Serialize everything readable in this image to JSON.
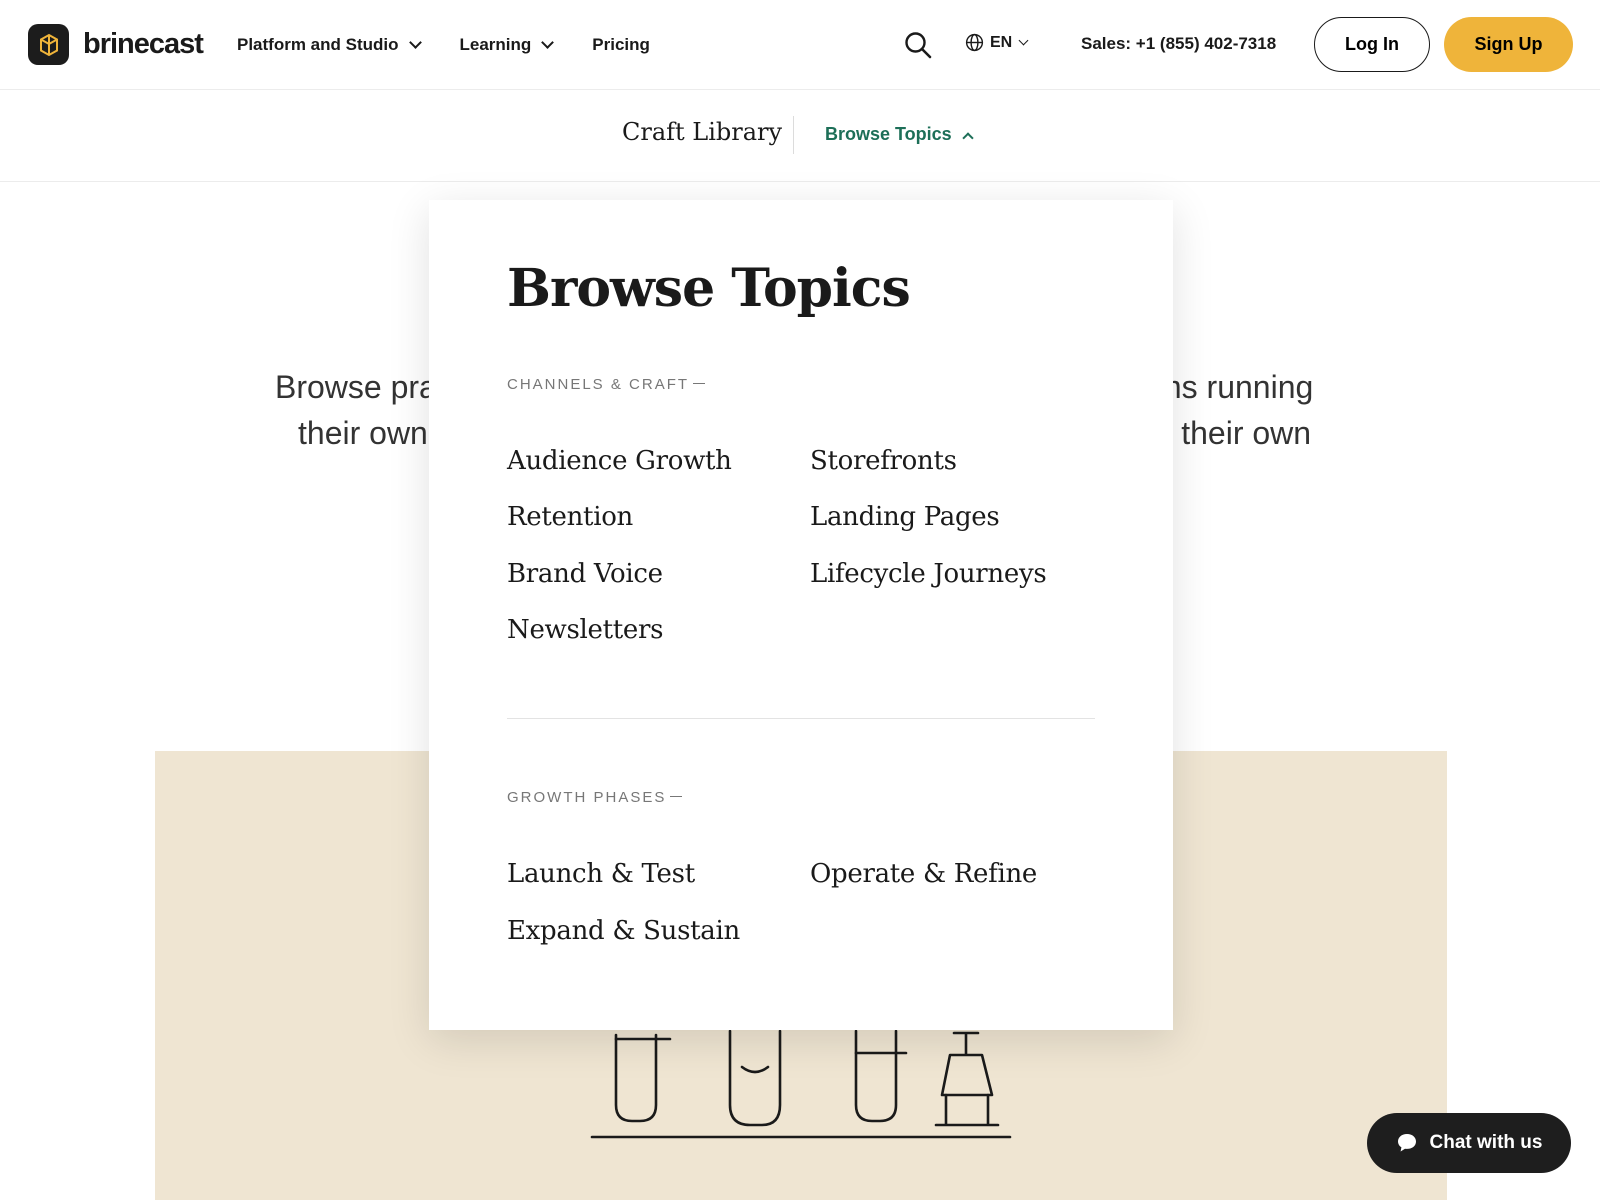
{
  "brand": {
    "name": "brinecast",
    "accent_color": "#efb43a",
    "link_color": "#1d6f58"
  },
  "topnav": {
    "links": [
      {
        "label": "Platform and Studio",
        "has_dropdown": true
      },
      {
        "label": "Learning",
        "has_dropdown": true
      },
      {
        "label": "Pricing",
        "has_dropdown": false
      }
    ],
    "search_icon": "search-icon",
    "language": "EN",
    "sales": "Sales: +1 (855) 402-7318",
    "login_label": "Log In",
    "signup_label": "Sign Up"
  },
  "subnav": {
    "library_label": "Craft Library",
    "browse_label": "Browse Topics"
  },
  "hero": {
    "left_line1": "Browse pra",
    "left_line2": "their own",
    "right_line1": "ms running",
    "right_line2": "their own"
  },
  "topics_panel": {
    "title": "Browse Topics",
    "sections": [
      {
        "label": "CHANNELS & CRAFT",
        "items": [
          "Audience Growth",
          "Storefronts",
          "Retention",
          "Landing Pages",
          "Brand Voice",
          "Lifecycle Journeys",
          "Newsletters"
        ]
      },
      {
        "label": "GROWTH PHASES",
        "items": [
          "Launch & Test",
          "Operate & Refine",
          "Expand & Sustain"
        ]
      }
    ]
  },
  "chat": {
    "label": "Chat with us"
  }
}
